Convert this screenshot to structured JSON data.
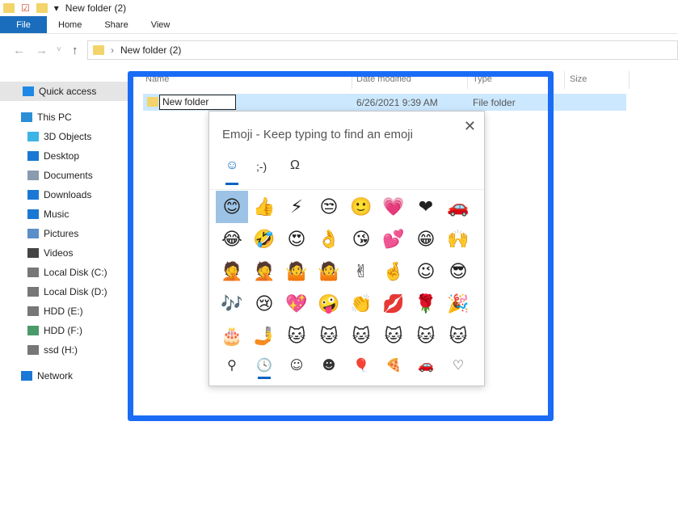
{
  "window": {
    "title": "New folder (2)"
  },
  "ribbon": {
    "tabs": [
      "File",
      "Home",
      "Share",
      "View"
    ]
  },
  "address": {
    "path": "New folder (2)",
    "separator": "›"
  },
  "nav": {
    "back": "←",
    "forward": "→",
    "recent": "˅",
    "up": "↑"
  },
  "sidebar": {
    "items": [
      {
        "label": "Quick access",
        "icon": "star-icon",
        "color": "#1e88e5"
      },
      {
        "label": "This PC",
        "icon": "computer-icon",
        "color": "#2b8fd6"
      },
      {
        "label": "3D Objects",
        "icon": "cube-icon",
        "color": "#3cb4e6"
      },
      {
        "label": "Desktop",
        "icon": "desktop-icon",
        "color": "#1a78d4"
      },
      {
        "label": "Documents",
        "icon": "document-icon",
        "color": "#8a9bb0"
      },
      {
        "label": "Downloads",
        "icon": "download-icon",
        "color": "#1a78d4"
      },
      {
        "label": "Music",
        "icon": "music-icon",
        "color": "#1a78d4"
      },
      {
        "label": "Pictures",
        "icon": "pictures-icon",
        "color": "#5a8fc8"
      },
      {
        "label": "Videos",
        "icon": "video-icon",
        "color": "#444"
      },
      {
        "label": "Local Disk (C:)",
        "icon": "drive-icon",
        "color": "#777"
      },
      {
        "label": "Local Disk (D:)",
        "icon": "drive-icon",
        "color": "#777"
      },
      {
        "label": "HDD (E:)",
        "icon": "drive-icon",
        "color": "#777"
      },
      {
        "label": "HDD (F:)",
        "icon": "drive-icon",
        "color": "#4a9a6a"
      },
      {
        "label": "ssd (H:)",
        "icon": "drive-icon",
        "color": "#777"
      },
      {
        "label": "Network",
        "icon": "network-icon",
        "color": "#1a78d4"
      }
    ]
  },
  "columns": [
    "Name",
    "Date modified",
    "Type",
    "Size"
  ],
  "file": {
    "name": "New folder",
    "date": "6/26/2021 9:39 AM",
    "type": "File folder"
  },
  "emoji_panel": {
    "title": "Emoji - Keep typing to find an emoji",
    "close": "✕",
    "tabs": [
      "☺",
      ";-)",
      "Ω"
    ],
    "emojis": [
      "😊",
      "👍",
      "⚡",
      "😒",
      "🙂",
      "💗",
      "❤",
      "🚗",
      "😂",
      "🤣",
      "😍",
      "👌",
      "😘",
      "💕",
      "😁",
      "🙌",
      "🤦",
      "🤦",
      "🤷",
      "🤷",
      "✌",
      "🤞",
      "😉",
      "😎",
      "🎶",
      "😢",
      "💖",
      "🤪",
      "👏",
      "💋",
      "🌹",
      "🎉",
      "🎂",
      "🤳",
      "🐱",
      "🐱",
      "🐱",
      "🐱",
      "🐱",
      "🐱"
    ],
    "categories": [
      {
        "glyph": "⚲",
        "name": "search"
      },
      {
        "glyph": "🕓",
        "name": "recent"
      },
      {
        "glyph": "☺",
        "name": "smileys"
      },
      {
        "glyph": "☻",
        "name": "people"
      },
      {
        "glyph": "🎈",
        "name": "celebration"
      },
      {
        "glyph": "🍕",
        "name": "food"
      },
      {
        "glyph": "🚗",
        "name": "travel"
      },
      {
        "glyph": "♡",
        "name": "symbols"
      }
    ]
  },
  "accent": "#1a6cf5"
}
